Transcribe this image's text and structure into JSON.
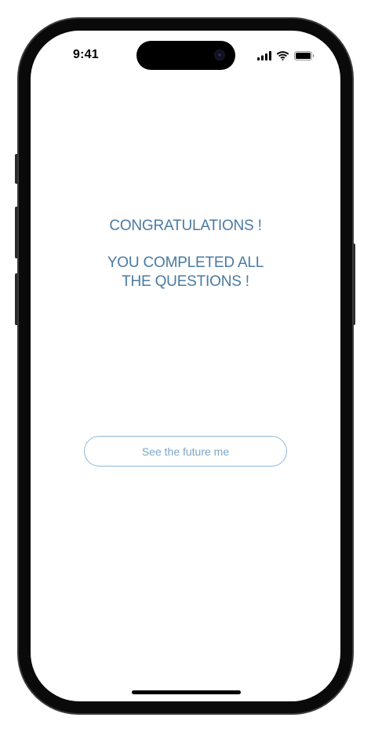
{
  "status_bar": {
    "time": "9:41",
    "icons": [
      "cellular-signal-icon",
      "wifi-icon",
      "battery-icon"
    ]
  },
  "content": {
    "title": "CONGRATULATIONS !",
    "subtitle_line1": "YOU COMPLETED ALL",
    "subtitle_line2": "THE QUESTIONS !"
  },
  "actions": {
    "future_button_label": "See the future me"
  },
  "colors": {
    "text_accent": "#4a7aa3",
    "button_border": "#8fb8da",
    "button_text": "#7aa6cc",
    "background": "#ffffff"
  }
}
